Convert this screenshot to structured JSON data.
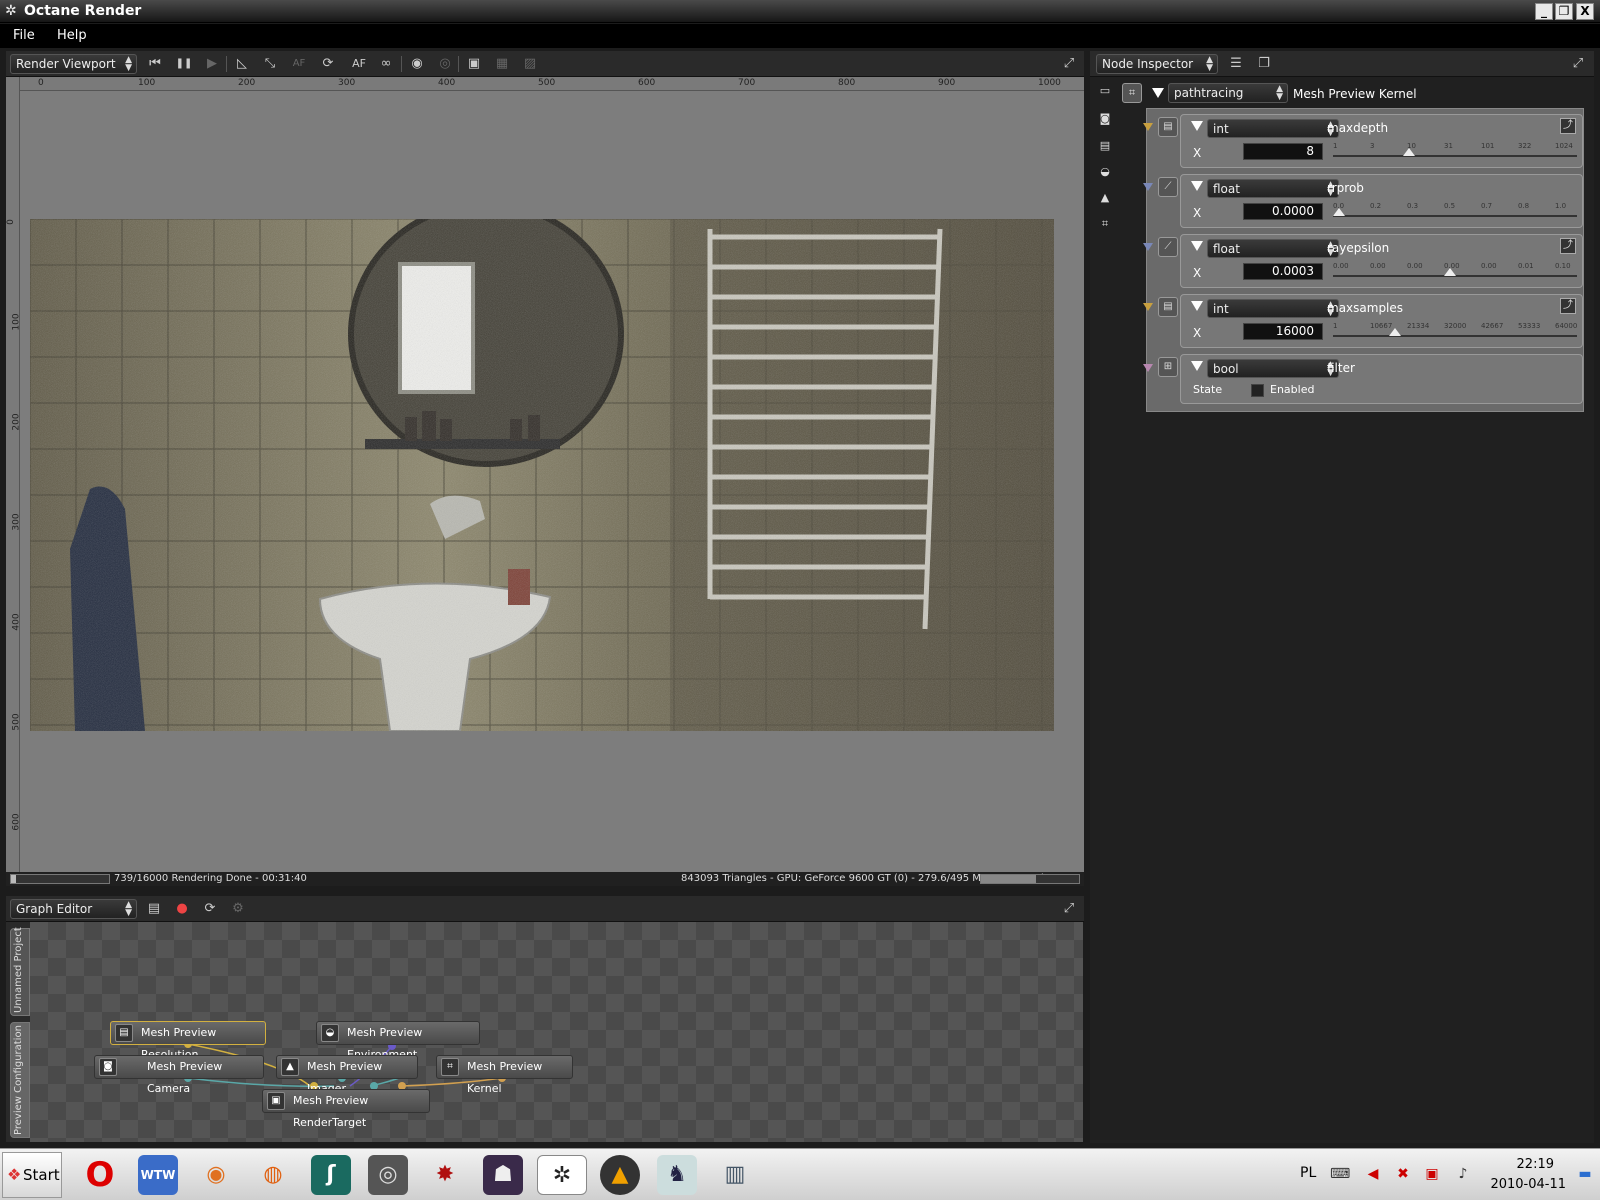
{
  "window": {
    "title": "Octane Render",
    "min_label": "_",
    "restore_label": "❐",
    "close_label": "X",
    "logo_glyph": "✲"
  },
  "menu": {
    "file": "File",
    "help": "Help"
  },
  "viewport": {
    "selector": "Render Viewport",
    "buttons": {
      "rewind": "⏮",
      "pause": "❚❚",
      "play": "▶",
      "af_label": "AF",
      "af_dim_label": "AF",
      "fullscreen": "⤢"
    },
    "ruler_h": [
      "0",
      "100",
      "200",
      "300",
      "400",
      "500",
      "600",
      "700",
      "800",
      "900",
      "1000"
    ],
    "ruler_v": [
      "0",
      "100",
      "200",
      "300",
      "400",
      "500",
      "600"
    ],
    "status_left": "739/16000 Rendering Done - 00:31:40",
    "status_right": "843093 Triangles - GPU: GeForce 9600 GT (0) - 279.6/495 MB Mem Used"
  },
  "inspector": {
    "selector": "Node Inspector",
    "kernel_type": "pathtracing",
    "kernel_name": "Mesh Preview Kernel",
    "params": [
      {
        "type": "int",
        "name": "maxdepth",
        "axis": "X",
        "value": "8",
        "ticks": [
          "1",
          "3",
          "10",
          "31",
          "101",
          "322",
          "1024"
        ],
        "slider_fraction": 0.3
      },
      {
        "type": "float",
        "name": "rrprob",
        "axis": "X",
        "value": "0.0000",
        "ticks": [
          "0.0",
          "0.2",
          "0.3",
          "0.5",
          "0.7",
          "0.8",
          "1.0"
        ],
        "slider_fraction": 0.0
      },
      {
        "type": "float",
        "name": "rayepsilon",
        "axis": "X",
        "value": "0.0003",
        "ticks": [
          "0.00",
          "0.00",
          "0.00",
          "0.00",
          "0.00",
          "0.01",
          "0.10"
        ],
        "slider_fraction": 0.48
      },
      {
        "type": "int",
        "name": "maxsamples",
        "axis": "X",
        "value": "16000",
        "ticks": [
          "1",
          "10667",
          "21334",
          "32000",
          "42667",
          "53333",
          "64000"
        ],
        "slider_fraction": 0.24
      }
    ],
    "filter": {
      "type": "bool",
      "name": "filter",
      "state_label": "State",
      "enabled_label": "Enabled",
      "enabled": false
    }
  },
  "graph": {
    "selector": "Graph Editor",
    "tabs": [
      "Unnamed Project",
      "Preview Configuration"
    ],
    "nodes": {
      "resolution": "Mesh Preview Resolution",
      "environment": "Mesh Preview Environment",
      "camera": "Mesh Preview Camera",
      "imager": "Mesh Preview Imager",
      "kernel": "Mesh Preview Kernel",
      "rendertarget": "Mesh Preview RenderTarget"
    },
    "fullscreen": "⤢"
  },
  "taskbar": {
    "start": "Start",
    "lang": "PL",
    "time": "22:19",
    "date": "2010-04-11",
    "apps": [
      "Opera",
      "WTW",
      "Blender",
      "Firefox",
      "Launcher",
      "Steam",
      "Diablo",
      "Game",
      "Octane",
      "VLC",
      "CS",
      "Archive"
    ]
  },
  "colors": {
    "accent": "#c8a040",
    "panel_bg": "#202020",
    "viewport_bg": "#7d7d7d"
  }
}
